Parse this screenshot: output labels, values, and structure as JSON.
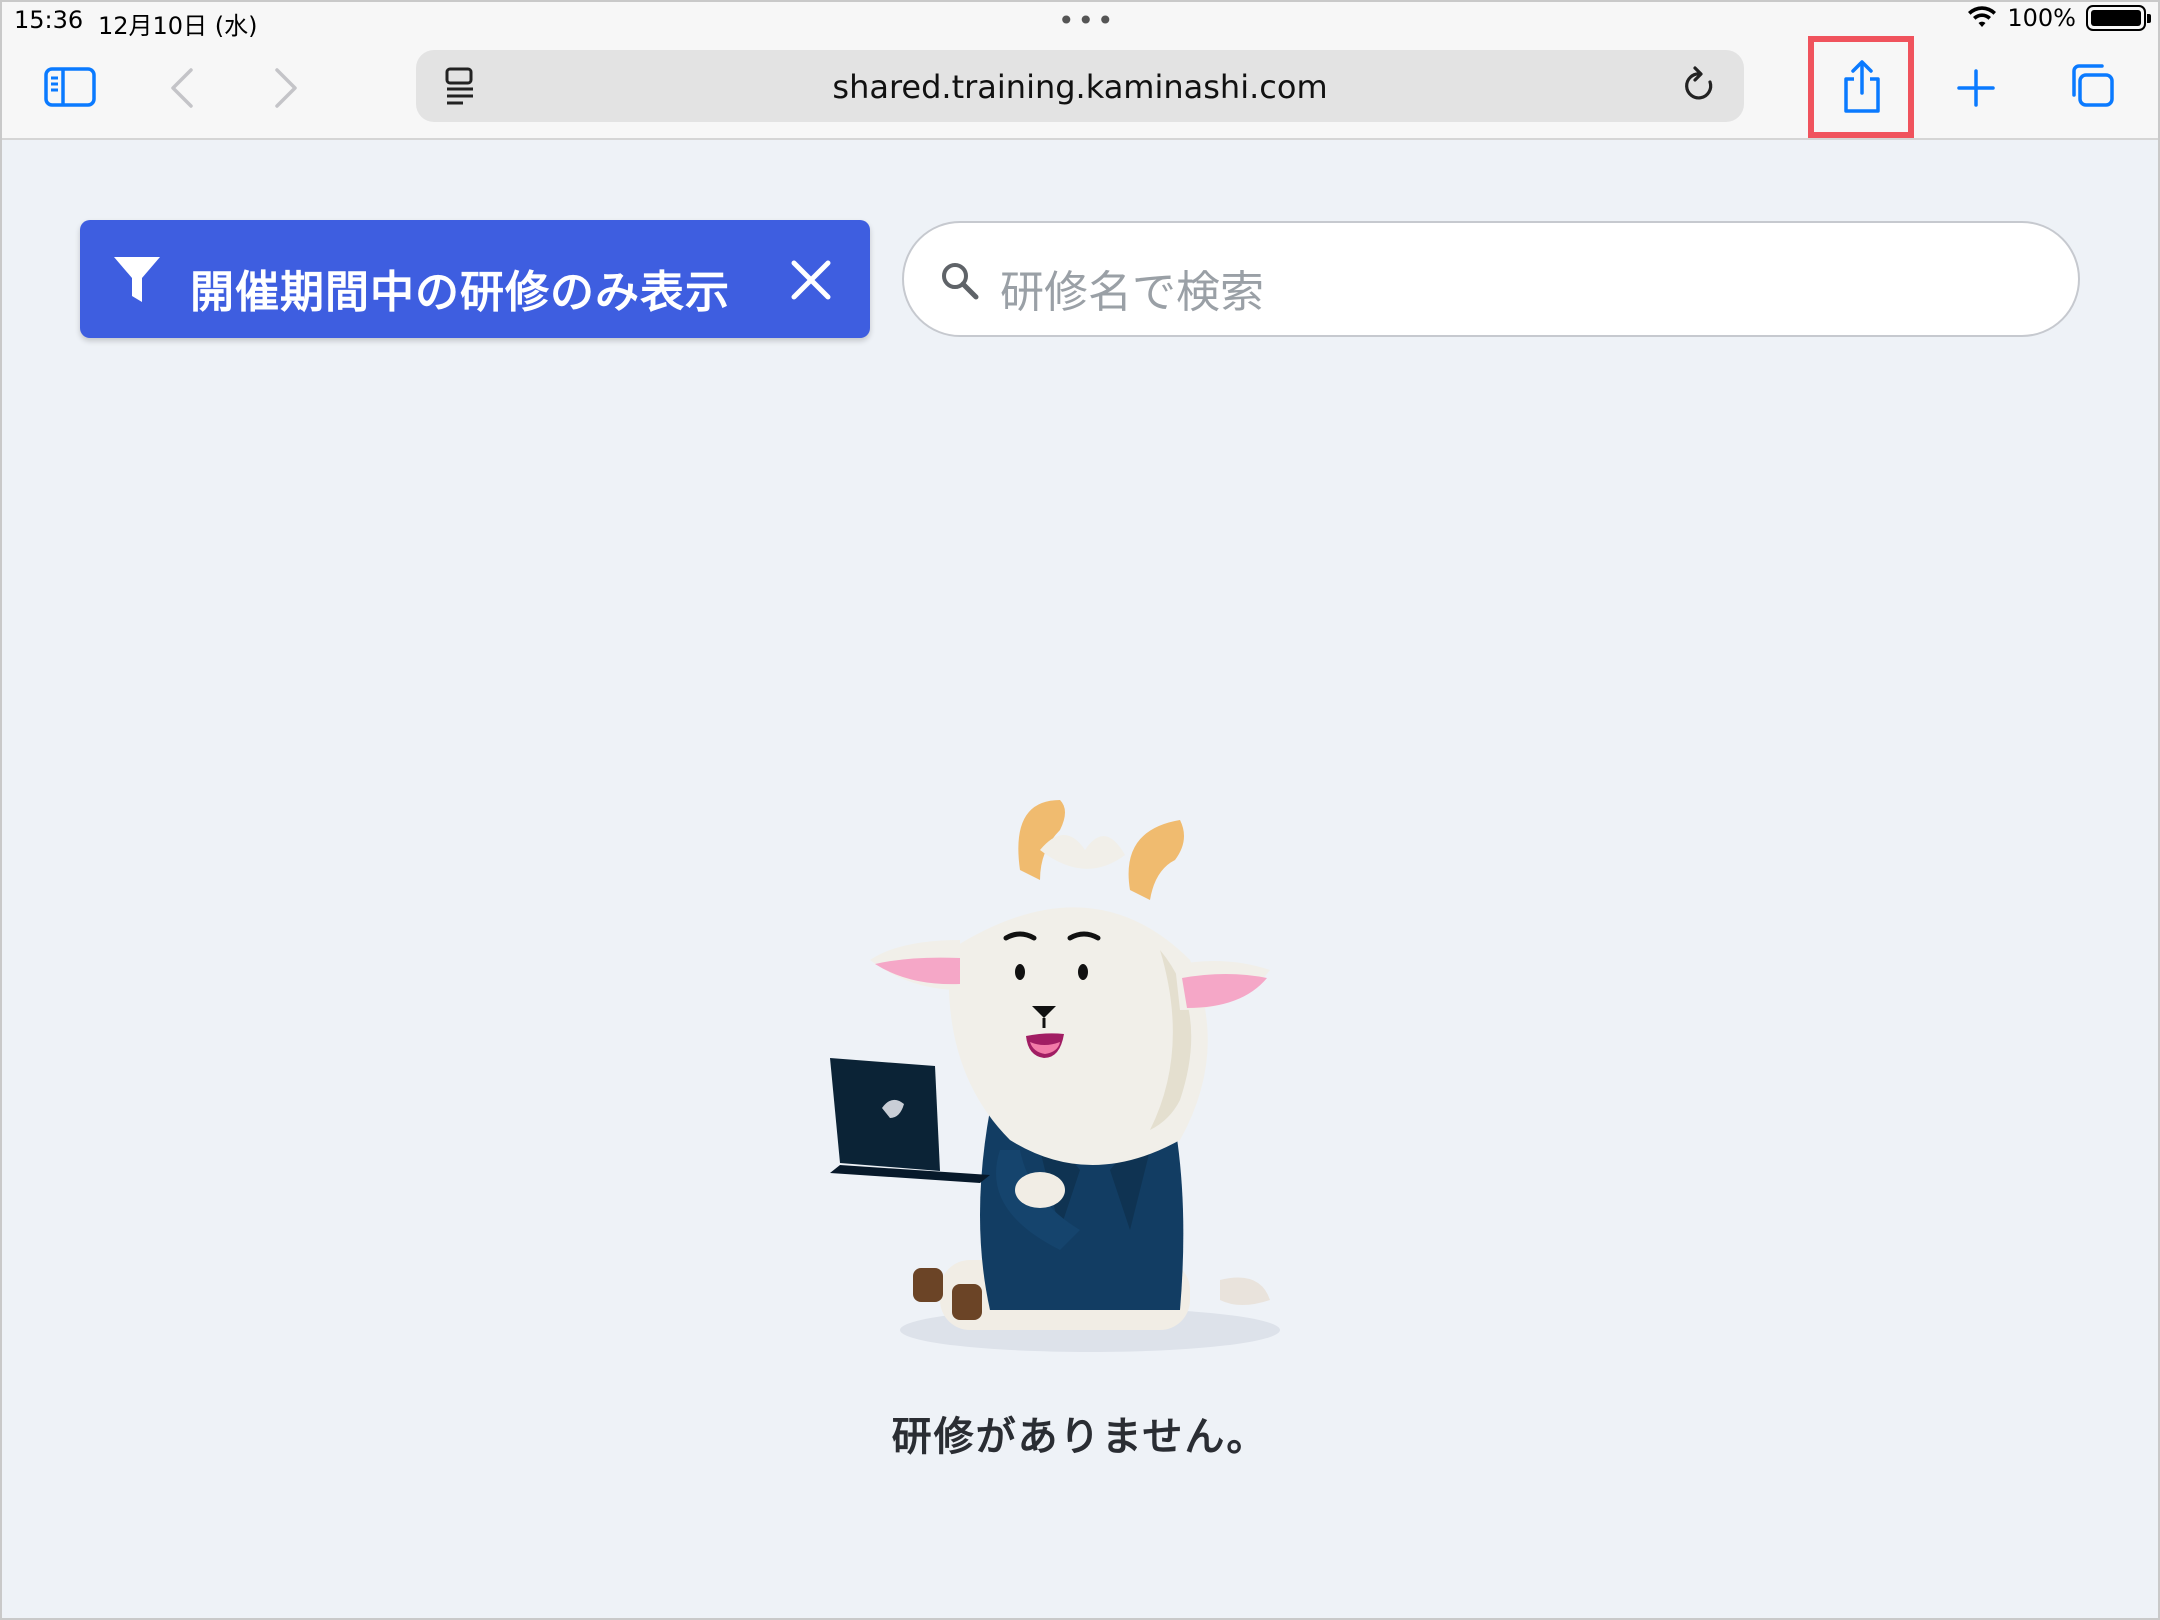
{
  "status_bar": {
    "time": "15:36",
    "date": "12月10日 (水)",
    "battery": "100%"
  },
  "browser": {
    "url": "shared.training.kaminashi.com",
    "icons": {
      "sidebar": "sidebar-icon",
      "back": "chevron-left-icon",
      "forward": "chevron-right-icon",
      "reader": "reader-icon",
      "reload": "reload-icon",
      "share": "share-icon",
      "new_tab": "plus-icon",
      "tabs": "tabs-icon"
    },
    "accent": "#0a7aff"
  },
  "filter": {
    "label": "開催期間中の研修のみ表示",
    "color": "#3e5ee0"
  },
  "search": {
    "placeholder": "研修名で検索"
  },
  "empty_state": {
    "message": "研修がありません。"
  },
  "annotation": {
    "highlight_color": "#f0535d"
  }
}
